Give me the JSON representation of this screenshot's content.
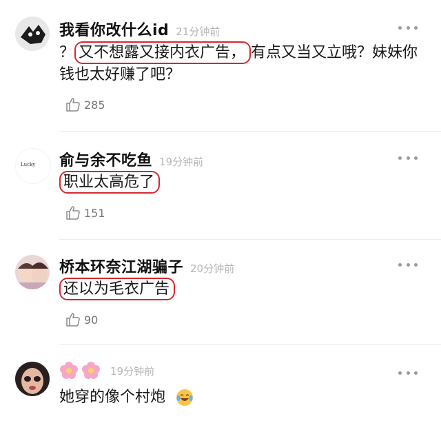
{
  "comments": [
    {
      "username": "我看你改什么id",
      "time": "21分钟前",
      "text_prefix": "？",
      "text_highlight": "又不想露又接内衣广告，",
      "text_suffix": "有点又当又立哦？妹妹你钱也太好赚了吧？",
      "likes": "285",
      "avatar_icon": "black-wolf-mask-avatar"
    },
    {
      "username": "俞与余不吃鱼",
      "time": "19分钟前",
      "text_highlight": "职业太高危了",
      "likes": "151",
      "avatar_icon": "lucky-text-avatar",
      "avatar_text": "Lucky"
    },
    {
      "username": "桥本环奈江湖骗子",
      "time": "20分钟前",
      "text_highlight": "还以为毛衣广告",
      "likes": "90",
      "avatar_icon": "photo-avatar"
    },
    {
      "username": "",
      "time": "19分钟前",
      "text": "她穿的像个村炮",
      "avatar_icon": "doll-face-avatar",
      "name_icons": [
        "pink-flower-emoji",
        "pink-flower-emoji"
      ],
      "text_emoji": "laughing-tears-emoji"
    }
  ],
  "colors": {
    "highlight_box": "#d6262d",
    "time": "#b5b5b5",
    "text": "#1a1a1a",
    "like": "#777777"
  }
}
